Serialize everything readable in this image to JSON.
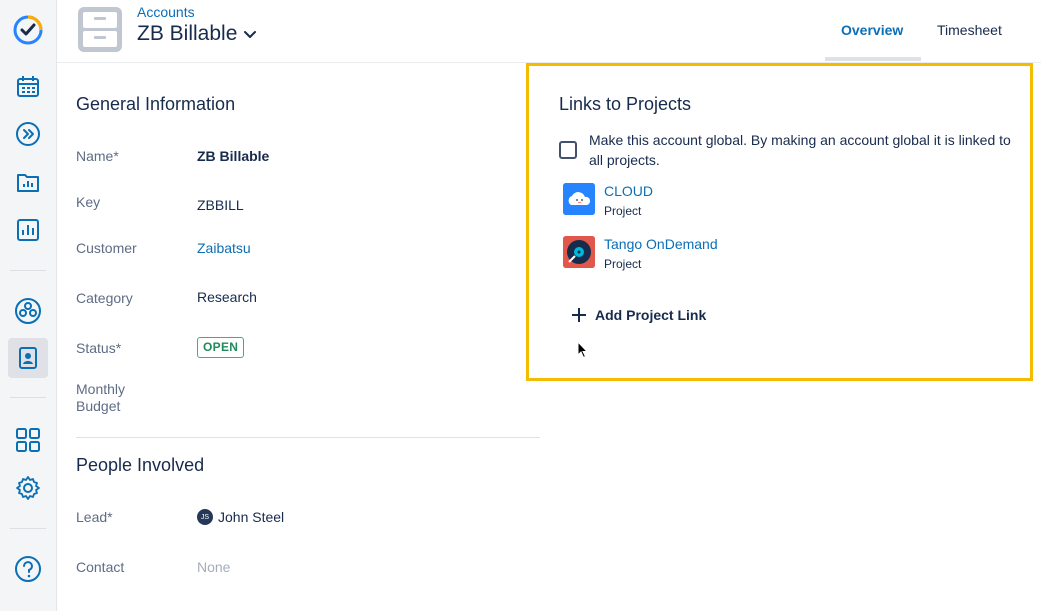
{
  "header": {
    "breadcrumb": "Accounts",
    "title": "ZB Billable",
    "tabs": [
      {
        "label": "Overview",
        "active": true
      },
      {
        "label": "Timesheet",
        "active": false
      }
    ]
  },
  "general": {
    "section_title": "General Information",
    "name_label": "Name*",
    "name_value": "ZB Billable",
    "key_label": "Key",
    "key_value": "ZBBILL",
    "customer_label": "Customer",
    "customer_value": "Zaibatsu",
    "category_label": "Category",
    "category_value": "Research",
    "status_label": "Status*",
    "status_value": "OPEN",
    "budget_label_line1": "Monthly",
    "budget_label_line2": "Budget"
  },
  "people": {
    "section_title": "People Involved",
    "lead_label": "Lead*",
    "lead_initials": "JS",
    "lead_name": "John Steel",
    "contact_label": "Contact",
    "contact_value": "None"
  },
  "links": {
    "section_title": "Links to Projects",
    "global_text": "Make this account global. By making an account global it is linked to all projects.",
    "projects": [
      {
        "name": "CLOUD",
        "type": "Project"
      },
      {
        "name": "Tango OnDemand",
        "type": "Project"
      }
    ],
    "add_label": "Add Project Link"
  },
  "colors": {
    "accent": "#0b6fb6",
    "highlight_border": "#f5bb00",
    "status_green": "#36b37e"
  },
  "icons": [
    "app-logo-icon",
    "calendar-icon",
    "forward-icon",
    "folder-chart-icon",
    "report-icon",
    "team-icon",
    "account-icon",
    "apps-grid-icon",
    "gear-icon",
    "help-icon"
  ]
}
